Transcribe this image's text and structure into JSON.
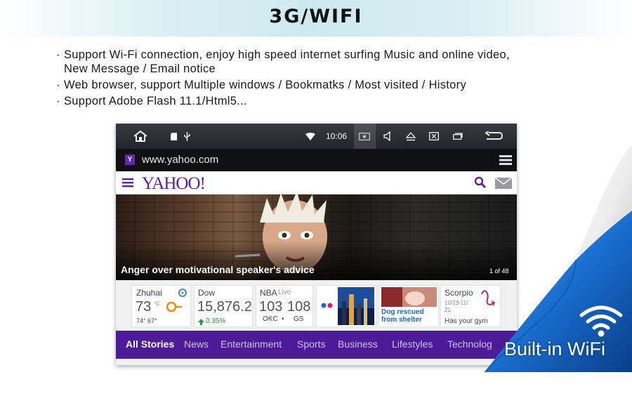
{
  "header": {
    "title": "3G/WIFI"
  },
  "features": [
    {
      "bullet": "·",
      "text": "Support Wi-Fi connection, enjoy high speed internet surfing Music and online video,\nNew Message / Email notice"
    },
    {
      "bullet": "·",
      "text": "Web browser, support Multiple windows / Bookmatks / Most visited / History"
    },
    {
      "bullet": "·",
      "text": "Support Adobe Flash 11.1/Html5..."
    }
  ],
  "statusbar": {
    "time": "10:06",
    "icons": [
      "home-icon",
      "sd-card-icon",
      "usb-icon",
      "wifi-icon",
      "screenshot-icon",
      "volume-icon",
      "eject-icon",
      "close-window-icon",
      "recent-apps-icon",
      "back-icon"
    ]
  },
  "browser": {
    "favicon": "Y",
    "url": "www.yahoo.com"
  },
  "yahoo": {
    "logo": "YAHOO!",
    "hero": {
      "caption": "Anger over motivational speaker's advice",
      "counter": "1 of 48"
    },
    "tiles": {
      "weather": {
        "city": "Zhuhai",
        "temp": "73",
        "unit": "°F",
        "range": "74° 67°"
      },
      "dow": {
        "label": "Dow",
        "value": "15,876.2",
        "change": "0.35%"
      },
      "nba": {
        "label": "NBA",
        "live": "Live",
        "score1": "103",
        "score2": "108",
        "team1": "OKC",
        "sep": "•",
        "team2": "GS"
      },
      "news": {
        "caption": "Dog rescued from shelter"
      },
      "horoscope": {
        "sign": "Scorpio",
        "dates": "10/23-11/\n21",
        "text": "Has your gym"
      }
    },
    "tabs": [
      "All Stories",
      "News",
      "Entertainment",
      "Sports",
      "Business",
      "Lifestyles",
      "Technolog"
    ]
  },
  "badge": {
    "text": "Built-in WiFi"
  },
  "colors": {
    "yahoo_purple": "#4b1b9a",
    "badge_blue": "#1a6fd0"
  }
}
